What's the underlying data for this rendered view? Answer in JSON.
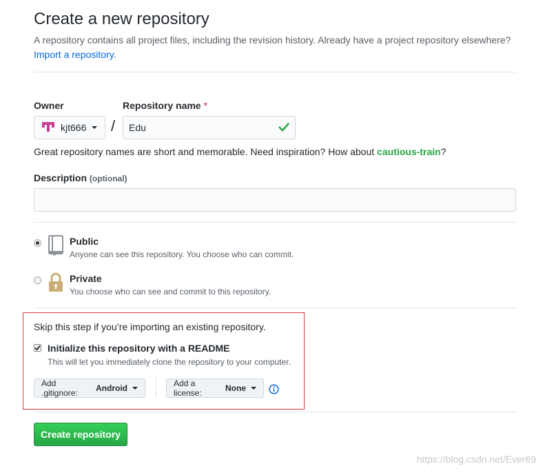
{
  "header": {
    "title": "Create a new repository",
    "subtitle": "A repository contains all project files, including the revision history. Already have a project repository elsewhere?",
    "import_link": "Import a repository."
  },
  "owner": {
    "label": "Owner",
    "value": "kjt666"
  },
  "repo_name": {
    "label": "Repository name",
    "required_mark": "*",
    "separator": "/",
    "value": "Edu"
  },
  "name_hint": {
    "prefix": "Great repository names are short and memorable. Need inspiration? How about ",
    "suggestion": "cautious-train",
    "suffix": "?"
  },
  "description": {
    "label": "Description",
    "optional": "(optional)",
    "value": ""
  },
  "visibility": {
    "public": {
      "title": "Public",
      "desc": "Anyone can see this repository. You choose who can commit.",
      "selected": true
    },
    "private": {
      "title": "Private",
      "desc": "You choose who can see and commit to this repository.",
      "selected": false
    }
  },
  "init": {
    "skip_note": "Skip this step if you’re importing an existing repository.",
    "readme_label": "Initialize this repository with a README",
    "readme_desc": "This will let you immediately clone the repository to your computer.",
    "readme_checked": true,
    "gitignore_label": "Add .gitignore:",
    "gitignore_value": "Android",
    "license_label": "Add a license:",
    "license_value": "None"
  },
  "submit": {
    "label": "Create repository"
  },
  "watermark": "https://blog.csdn.net/Ever69",
  "colors": {
    "link": "#0366d6",
    "success": "#28a745",
    "required": "#cb2431",
    "highlight_box": "#e0393e"
  },
  "icons": {
    "owner_avatar": "owner-avatar-icon",
    "valid": "check-icon",
    "public": "repo-book-icon",
    "private": "lock-icon",
    "info": "info-icon"
  }
}
